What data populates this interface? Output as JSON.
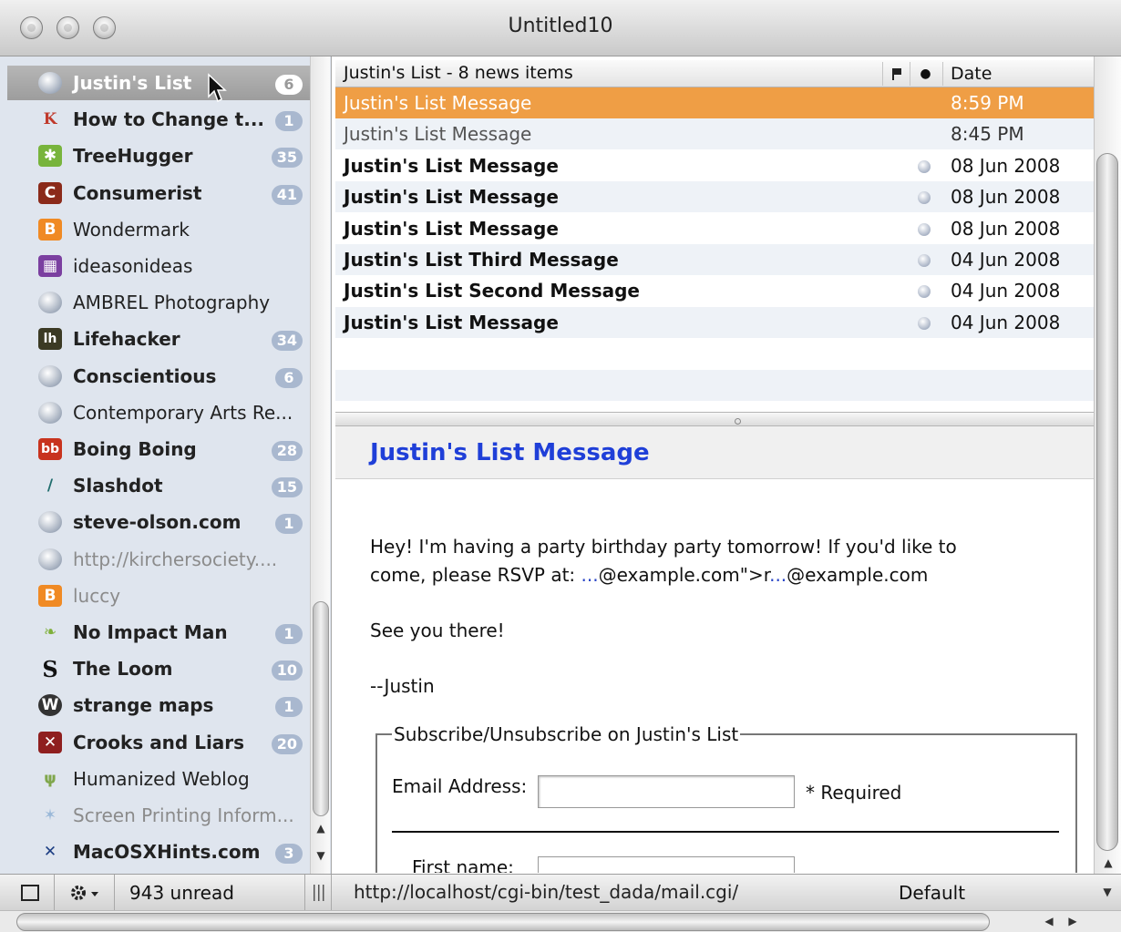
{
  "window": {
    "title": "Untitled10"
  },
  "sidebar": {
    "items": [
      {
        "label": "Justin's List",
        "badge": "6",
        "icon": "globe-icon",
        "state": "selected"
      },
      {
        "label": "How to Change t...",
        "badge": "1",
        "icon": "gk-logo-icon",
        "state": "normal"
      },
      {
        "label": "TreeHugger",
        "badge": "35",
        "icon": "treehugger-icon",
        "state": "normal"
      },
      {
        "label": "Consumerist",
        "badge": "41",
        "icon": "consumerist-icon",
        "state": "normal"
      },
      {
        "label": "Wondermark",
        "badge": "",
        "icon": "blogger-icon",
        "state": "plain"
      },
      {
        "label": "ideasonideas",
        "badge": "",
        "icon": "ideasonideas-icon",
        "state": "plain"
      },
      {
        "label": "AMBREL Photography",
        "badge": "",
        "icon": "globe-icon",
        "state": "plain"
      },
      {
        "label": "Lifehacker",
        "badge": "34",
        "icon": "lifehacker-icon",
        "state": "normal"
      },
      {
        "label": "Conscientious",
        "badge": "6",
        "icon": "globe-icon",
        "state": "normal"
      },
      {
        "label": "Contemporary Arts Re...",
        "badge": "",
        "icon": "globe-icon",
        "state": "plain"
      },
      {
        "label": "Boing Boing",
        "badge": "28",
        "icon": "boingboing-icon",
        "state": "normal"
      },
      {
        "label": "Slashdot",
        "badge": "15",
        "icon": "slashdot-icon",
        "state": "normal"
      },
      {
        "label": "steve-olson.com",
        "badge": "1",
        "icon": "globe-icon",
        "state": "normal"
      },
      {
        "label": "http://kirchersociety....",
        "badge": "",
        "icon": "globe-icon",
        "state": "dim"
      },
      {
        "label": "luccy",
        "badge": "",
        "icon": "blogger-icon",
        "state": "dim"
      },
      {
        "label": "No Impact Man",
        "badge": "1",
        "icon": "leaf-icon",
        "state": "normal"
      },
      {
        "label": "The Loom",
        "badge": "10",
        "icon": "loom-s-icon",
        "state": "normal"
      },
      {
        "label": "strange maps",
        "badge": "1",
        "icon": "wordpress-icon",
        "state": "normal"
      },
      {
        "label": "Crooks and Liars",
        "badge": "20",
        "icon": "crooks-liars-icon",
        "state": "normal"
      },
      {
        "label": "Humanized Weblog",
        "badge": "",
        "icon": "humanized-icon",
        "state": "plain"
      },
      {
        "label": "Screen Printing Inform...",
        "badge": "",
        "icon": "sparkle-icon",
        "state": "dim"
      },
      {
        "label": "MacOSXHints.com",
        "badge": "3",
        "icon": "x-logo-icon",
        "state": "normal"
      }
    ]
  },
  "message_list": {
    "title": "Justin's List - 8 news items",
    "date_header": "Date",
    "dot_header": "●",
    "rows": [
      {
        "subject": "Justin's List Message",
        "date": "8:59 PM",
        "state": "selected",
        "unread": false
      },
      {
        "subject": "Justin's List Message",
        "date": "8:45 PM",
        "state": "read",
        "unread": false
      },
      {
        "subject": "Justin's List Message",
        "date": "08 Jun 2008",
        "state": "unread",
        "unread": true
      },
      {
        "subject": "Justin's List Message",
        "date": "08 Jun 2008",
        "state": "unread",
        "unread": true
      },
      {
        "subject": "Justin's List Message",
        "date": "08 Jun 2008",
        "state": "unread",
        "unread": true
      },
      {
        "subject": "Justin's List Third Message",
        "date": "04 Jun 2008",
        "state": "unread",
        "unread": true
      },
      {
        "subject": "Justin's List Second Message",
        "date": "04 Jun 2008",
        "state": "unread",
        "unread": true
      },
      {
        "subject": "Justin's List Message",
        "date": "04 Jun 2008",
        "state": "unread",
        "unread": true
      }
    ]
  },
  "message": {
    "subject": "Justin's List Message",
    "line1": "Hey! I'm having a party birthday party tomorrow! If you'd like to",
    "line2_pre": "come, please RSVP at: ",
    "line2_link": "...",
    "line2_mid": "@example.com\">r",
    "line2_link2": "...",
    "line2_post": "@example.com",
    "line3": "See you there!",
    "signature": "--Justin",
    "form": {
      "legend": "Subscribe/Unsubscribe on Justin's List",
      "email_label": "Email Address:",
      "required": "* Required",
      "first_name_label": "First name:"
    }
  },
  "status": {
    "unread": "943 unread",
    "url": "http://localhost/cgi-bin/test_dada/mail.cgi/",
    "style": "Default"
  },
  "colors": {
    "selection_orange": "#ef9e45",
    "sidebar_bg": "#dfe5ee",
    "badge": "#a9b8cf",
    "subject_blue": "#1f3fd8"
  }
}
